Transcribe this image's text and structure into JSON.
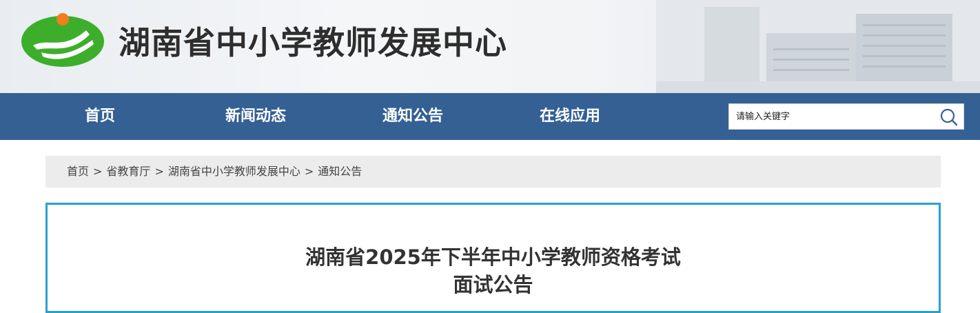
{
  "header": {
    "site_title": "湖南省中小学教师发展中心"
  },
  "nav": {
    "items": [
      {
        "label": "首页"
      },
      {
        "label": "新闻动态"
      },
      {
        "label": "通知公告"
      },
      {
        "label": "在线应用"
      }
    ],
    "search": {
      "placeholder": "请输入关键字",
      "value": ""
    }
  },
  "breadcrumb": {
    "items": [
      {
        "label": "首页"
      },
      {
        "label": "省教育厅"
      },
      {
        "label": "湖南省中小学教师发展中心"
      },
      {
        "label": "通知公告"
      }
    ],
    "separator": ">"
  },
  "article": {
    "title_line1": "湖南省2025年下半年中小学教师资格考试",
    "title_line2": "面试公告"
  },
  "colors": {
    "nav_bg": "#346094",
    "content_border": "#2a9fd0",
    "logo_green": "#3dae2b",
    "logo_orange": "#f07e1d"
  },
  "icons": {
    "search": "search-icon",
    "logo": "site-logo"
  }
}
